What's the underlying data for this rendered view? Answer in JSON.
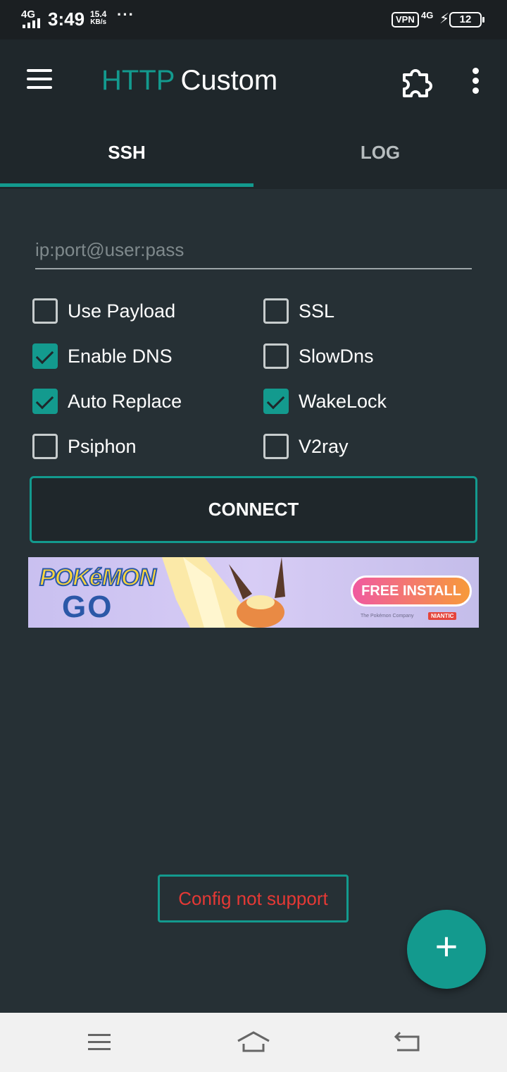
{
  "status_bar": {
    "network": "4G",
    "time": "3:49",
    "speed_value": "15.4",
    "speed_unit": "KB/s",
    "more": "···",
    "vpn": "VPN",
    "data_type": "4G",
    "battery": "12"
  },
  "app_bar": {
    "title_part1": "HTTP",
    "title_part2": "Custom"
  },
  "tabs": [
    {
      "label": "SSH",
      "selected": true
    },
    {
      "label": "LOG",
      "selected": false
    }
  ],
  "server_input": {
    "value": "",
    "placeholder": "ip:port@user:pass"
  },
  "options": [
    {
      "label": "Use Payload",
      "checked": false
    },
    {
      "label": "SSL",
      "checked": false
    },
    {
      "label": "Enable DNS",
      "checked": true
    },
    {
      "label": "SlowDns",
      "checked": false
    },
    {
      "label": "Auto Replace",
      "checked": true
    },
    {
      "label": "WakeLock",
      "checked": true
    },
    {
      "label": "Psiphon",
      "checked": false
    },
    {
      "label": "V2ray",
      "checked": false
    }
  ],
  "connect_button": "CONNECT",
  "ad": {
    "logo_top": "POKéMON",
    "logo_bottom": "GO",
    "cta": "FREE INSTALL",
    "fine_print": "The Pokémon Company",
    "brand": "NIANTIC"
  },
  "toast": "Config not support",
  "fab_symbol": "+",
  "colors": {
    "accent": "#139a8e",
    "app_bar": "#1f272b",
    "background": "#263035",
    "error": "#e53935"
  }
}
